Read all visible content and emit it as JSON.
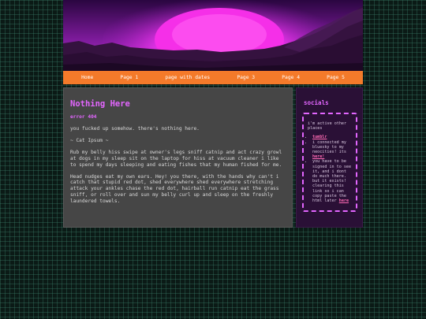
{
  "nav": {
    "items": [
      {
        "label": "Home"
      },
      {
        "label": "Page 1"
      },
      {
        "label": "page with dates"
      },
      {
        "label": "Page 3"
      },
      {
        "label": "Page 4"
      },
      {
        "label": "Page 5"
      }
    ]
  },
  "main": {
    "title": "Nothing Here",
    "error": "error 404",
    "paragraphs": [
      "you fucked up somehow. there's nothing here.",
      "~ Cat Ipsum ~",
      "Rub my belly hiss swipe at owner's legs sniff catnip and act crazy growl at dogs in my sleep sit on the laptop for hiss at vacuum cleaner i like to spend my days sleeping and eating fishes that my human fished for me.",
      "Head nudges eat my own ears. Hey! you there, with the hands why can't i catch that stupid red dot, shed everywhere shed everywhere stretching attack your ankles chase the red dot, hairball run catnip eat the grass sniff, or roll over and sun my belly curl up and sleep on the freshly laundered towels."
    ]
  },
  "sidebar": {
    "title": "socials",
    "intro": "i'm active other places",
    "item1_link": "tumblr",
    "item2_text": "i connected my bluesky to my neocities! its",
    "item2_link": "here!",
    "item3_text": "you have to be signed in to see it, and i dont do much there. but it exists! clearing this link so i can copy paste the html later",
    "item3_link": "here"
  },
  "colors": {
    "accent": "#e366ff",
    "nav": "#f47a2a",
    "link": "#ff6ab4"
  }
}
